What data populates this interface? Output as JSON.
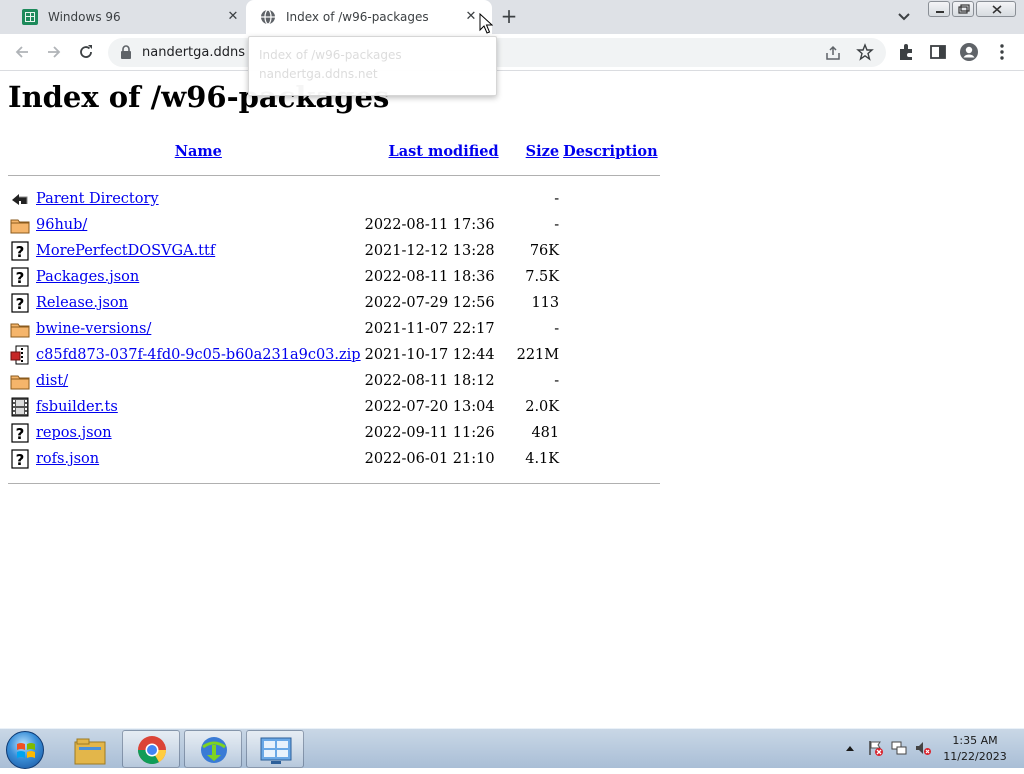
{
  "browser": {
    "tabs": [
      {
        "title": "Windows 96",
        "icon": "windows96-favicon",
        "active": false
      },
      {
        "title": "Index of /w96-packages",
        "icon": "globe-icon",
        "active": true
      }
    ],
    "address": {
      "url": "nandertga.ddns"
    },
    "hovercard": {
      "title": "Index of /w96-packages",
      "domain": "nandertga.ddns.net"
    }
  },
  "page": {
    "heading": "Index of /w96-packages",
    "columns": {
      "name": "Name",
      "last_modified": "Last modified",
      "size": "Size",
      "description": "Description"
    },
    "rows": [
      {
        "icon": "back-arrow-icon",
        "name": "Parent Directory",
        "modified": "",
        "size": "-",
        "description": ""
      },
      {
        "icon": "folder-icon",
        "name": "96hub/",
        "modified": "2022-08-11 17:36",
        "size": "-",
        "description": ""
      },
      {
        "icon": "unknown-file-icon",
        "name": "MorePerfectDOSVGA.ttf",
        "modified": "2021-12-12 13:28",
        "size": "76K",
        "description": ""
      },
      {
        "icon": "unknown-file-icon",
        "name": "Packages.json",
        "modified": "2022-08-11 18:36",
        "size": "7.5K",
        "description": ""
      },
      {
        "icon": "unknown-file-icon",
        "name": "Release.json",
        "modified": "2022-07-29 12:56",
        "size": "113",
        "description": ""
      },
      {
        "icon": "folder-icon",
        "name": "bwine-versions/",
        "modified": "2021-11-07 22:17",
        "size": "-",
        "description": ""
      },
      {
        "icon": "compressed-file-icon",
        "name": "c85fd873-037f-4fd0-9c05-b60a231a9c03.zip",
        "modified": "2021-10-17 12:44",
        "size": "221M",
        "description": ""
      },
      {
        "icon": "folder-icon",
        "name": "dist/",
        "modified": "2022-08-11 18:12",
        "size": "-",
        "description": ""
      },
      {
        "icon": "film-file-icon",
        "name": "fsbuilder.ts",
        "modified": "2022-07-20 13:04",
        "size": "2.0K",
        "description": ""
      },
      {
        "icon": "unknown-file-icon",
        "name": "repos.json",
        "modified": "2022-09-11 11:26",
        "size": "481",
        "description": ""
      },
      {
        "icon": "unknown-file-icon",
        "name": "rofs.json",
        "modified": "2022-06-01 21:10",
        "size": "4.1K",
        "description": ""
      }
    ]
  },
  "taskbar": {
    "clock_time": "1:35 AM",
    "clock_date": "11/22/2023",
    "pinned": [
      "file-explorer-icon",
      "chrome-icon",
      "download-manager-icon",
      "control-panel-icon"
    ]
  },
  "colors": {
    "link": "#0000ee",
    "tabstrip": "#dee1e6",
    "omnibox": "#f1f3f4"
  }
}
